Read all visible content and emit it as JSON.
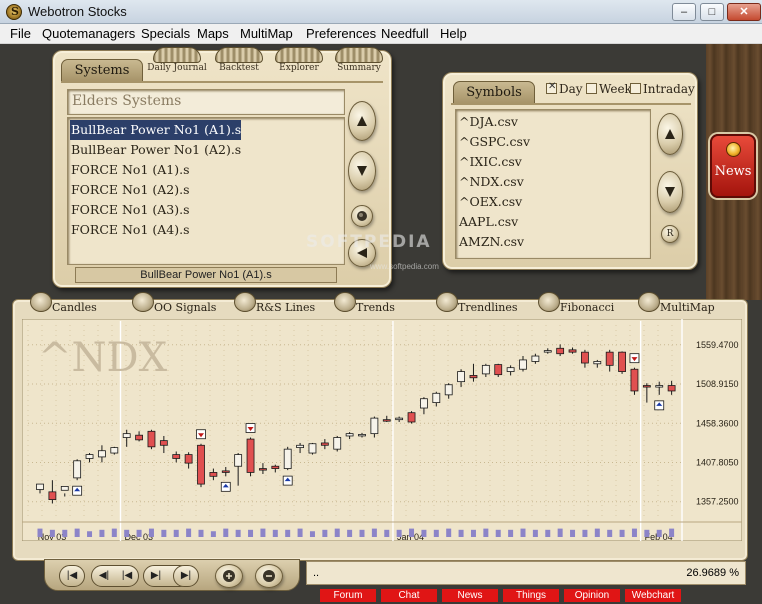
{
  "window": {
    "title": "Webotron Stocks",
    "minimize": "–",
    "maximize": "□",
    "close": "✕"
  },
  "menu": [
    "File",
    "Quotemanagers",
    "Specials",
    "Maps",
    "MultiMap",
    "Preferences",
    "Needfull",
    "Help"
  ],
  "systems_panel": {
    "tab": "Systems",
    "drum_tabs": [
      "Daily Journal",
      "Backtest",
      "Explorer",
      "Summary"
    ],
    "heading": "Elders Systems",
    "items": [
      "BullBear Power No1 (A1).s",
      "BullBear Power No1 (A2).s",
      "FORCE No1 (A1).s",
      "FORCE No1 (A2).s",
      "FORCE No1 (A3).s",
      "FORCE No1 (A4).s"
    ],
    "selected_index": 0,
    "status": "BullBear Power No1 (A1).s"
  },
  "symbols_panel": {
    "tab": "Symbols",
    "options": [
      {
        "label": "Day",
        "checked": true
      },
      {
        "label": "Week",
        "checked": false
      },
      {
        "label": "Intraday",
        "checked": false
      }
    ],
    "items": [
      "^DJA.csv",
      "^GSPC.csv",
      "^IXIC.csv",
      "^NDX.csv",
      "^OEX.csv",
      "AAPL.csv",
      "AMZN.csv"
    ],
    "r_button": "R"
  },
  "news": {
    "label": "News"
  },
  "chart_tabs": [
    "Candles",
    "OO Signals",
    "R&S Lines",
    "Trends",
    "Trendlines",
    "Fibonacci",
    "MultiMap"
  ],
  "watermark": {
    "text": "SOFTPEDIA",
    "url": "www.softpedia.com"
  },
  "chart_data": {
    "type": "candlestick",
    "symbol": "^NDX",
    "y_ticks": [
      "1559.4700",
      "1508.9150",
      "1458.3600",
      "1407.8050",
      "1357.2500"
    ],
    "y_tick_values": [
      1559.47,
      1508.915,
      1458.36,
      1407.805,
      1357.25
    ],
    "ylim": [
      1335,
      1585
    ],
    "x_labels": [
      "Nov 03",
      "Dec 03",
      "Jan 04",
      "Feb 04"
    ],
    "x_label_index": [
      0,
      7,
      29,
      49
    ],
    "candles": [
      [
        1373,
        1380,
        1368,
        1373
      ],
      [
        1370,
        1360,
        1385,
        1355
      ],
      [
        1372,
        1377,
        1364,
        1368
      ],
      [
        1388,
        1410,
        1385,
        1412
      ],
      [
        1413,
        1418,
        1408,
        1420
      ],
      [
        1415,
        1423,
        1408,
        1430
      ],
      [
        1420,
        1427,
        1418,
        1428
      ],
      [
        1440,
        1445,
        1428,
        1450
      ],
      [
        1443,
        1437,
        1435,
        1448
      ],
      [
        1448,
        1428,
        1425,
        1450
      ],
      [
        1436,
        1430,
        1420,
        1442
      ],
      [
        1418,
        1413,
        1408,
        1422
      ],
      [
        1418,
        1407,
        1400,
        1421
      ],
      [
        1430,
        1380,
        1376,
        1432
      ],
      [
        1395,
        1390,
        1385,
        1400
      ],
      [
        1397,
        1395,
        1390,
        1402
      ],
      [
        1403,
        1418,
        1378,
        1420
      ],
      [
        1438,
        1395,
        1390,
        1440
      ],
      [
        1400,
        1398,
        1393,
        1407
      ],
      [
        1403,
        1400,
        1395,
        1405
      ],
      [
        1400,
        1425,
        1398,
        1428
      ],
      [
        1427,
        1430,
        1420,
        1433
      ],
      [
        1420,
        1432,
        1418,
        1433
      ],
      [
        1433,
        1430,
        1425,
        1438
      ],
      [
        1425,
        1440,
        1422,
        1442
      ],
      [
        1442,
        1445,
        1438,
        1447
      ],
      [
        1443,
        1444,
        1440,
        1446
      ],
      [
        1445,
        1465,
        1440,
        1467
      ],
      [
        1463,
        1462,
        1460,
        1468
      ],
      [
        1463,
        1465,
        1460,
        1467
      ],
      [
        1472,
        1460,
        1458,
        1474
      ],
      [
        1478,
        1490,
        1470,
        1492
      ],
      [
        1485,
        1497,
        1480,
        1499
      ],
      [
        1495,
        1508,
        1490,
        1510
      ],
      [
        1512,
        1525,
        1505,
        1528
      ],
      [
        1520,
        1517,
        1512,
        1535
      ],
      [
        1522,
        1533,
        1518,
        1535
      ],
      [
        1534,
        1521,
        1518,
        1535
      ],
      [
        1525,
        1530,
        1520,
        1533
      ],
      [
        1528,
        1540,
        1525,
        1545
      ],
      [
        1538,
        1545,
        1535,
        1548
      ],
      [
        1552,
        1552,
        1548,
        1555
      ],
      [
        1555,
        1548,
        1545,
        1560
      ],
      [
        1553,
        1550,
        1548,
        1556
      ],
      [
        1550,
        1536,
        1530,
        1553
      ],
      [
        1535,
        1538,
        1530,
        1540
      ],
      [
        1550,
        1533,
        1525,
        1553
      ],
      [
        1550,
        1525,
        1522,
        1551
      ],
      [
        1528,
        1500,
        1495,
        1530
      ],
      [
        1507,
        1505,
        1485,
        1510
      ],
      [
        1505,
        1507,
        1495,
        1512
      ],
      [
        1507,
        1500,
        1495,
        1513
      ]
    ],
    "volume": [
      5,
      5,
      5,
      5,
      4,
      5,
      5,
      5,
      5,
      5,
      5,
      5,
      5,
      5,
      4,
      5,
      5,
      5,
      5,
      5,
      5,
      5,
      4,
      5,
      5,
      5,
      5,
      5,
      5,
      5,
      5,
      5,
      5,
      5,
      5,
      5,
      5,
      5,
      5,
      5,
      5,
      5,
      5,
      5,
      5,
      5,
      5,
      5,
      5,
      5,
      5,
      5
    ],
    "signals": [
      {
        "index": 3,
        "type": "buy"
      },
      {
        "index": 13,
        "type": "sell"
      },
      {
        "index": 15,
        "type": "buy"
      },
      {
        "index": 17,
        "type": "sell"
      },
      {
        "index": 20,
        "type": "buy"
      },
      {
        "index": 48,
        "type": "sell"
      },
      {
        "index": 50,
        "type": "buy"
      }
    ]
  },
  "status": {
    "left": "..",
    "right": "26.9689 %"
  },
  "bottom_links": [
    "Forum",
    "Chat",
    "News",
    "Things",
    "Opinion",
    "Webchart"
  ]
}
